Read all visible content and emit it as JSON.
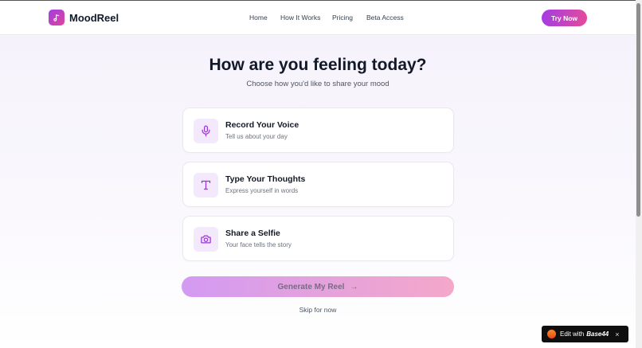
{
  "brand": {
    "name": "MoodReel",
    "logo_icon": "music-note-icon",
    "accent_from": "#a13de6",
    "accent_to": "#e0459a"
  },
  "nav": {
    "items": [
      "Home",
      "How It Works",
      "Pricing",
      "Beta Access"
    ],
    "cta": "Try Now"
  },
  "hero": {
    "title": "How are you feeling today?",
    "subtitle": "Choose how you'd like to share your mood"
  },
  "options": [
    {
      "title": "Record Your Voice",
      "desc": "Tell us about your day",
      "icon": "microphone-icon"
    },
    {
      "title": "Type Your Thoughts",
      "desc": "Express yourself in words",
      "icon": "text-icon"
    },
    {
      "title": "Share a Selfie",
      "desc": "Your face tells the story",
      "icon": "camera-icon"
    }
  ],
  "actions": {
    "generate": "Generate My Reel",
    "arrow": "→",
    "skip": "Skip for now"
  },
  "badge": {
    "text": "Edit with",
    "brand": "Base44",
    "close": "×"
  }
}
